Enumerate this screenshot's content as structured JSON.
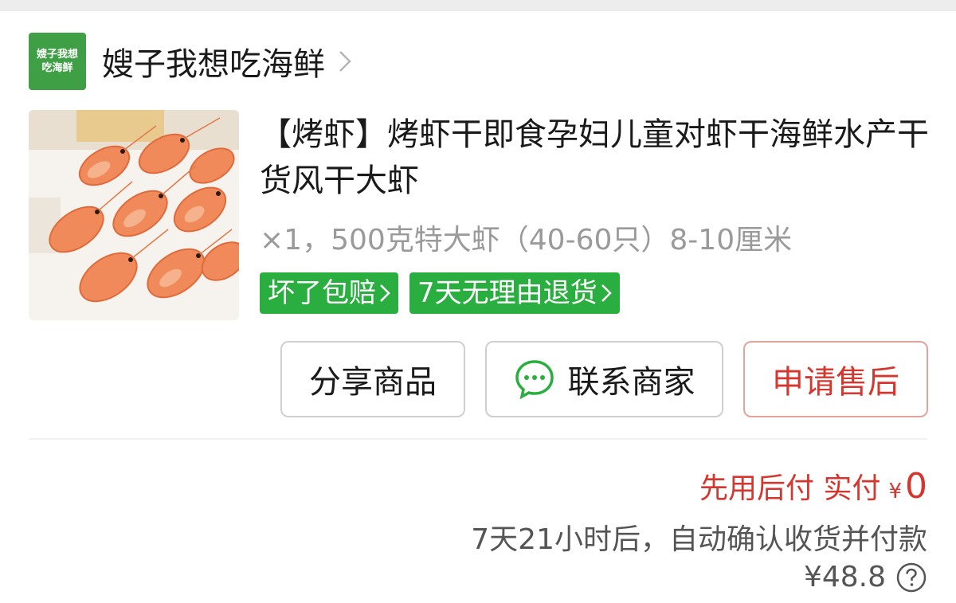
{
  "shop": {
    "logo_line1": "嫂子我想",
    "logo_line2": "吃海鲜",
    "name": "嫂子我想吃海鲜"
  },
  "product": {
    "title": "【烤虾】烤虾干即食孕妇儿童对虾干海鲜水产干货风干大虾",
    "spec": "×1，500克特大虾（40-60只）8-10厘米",
    "tags": [
      "坏了包赔",
      "7天无理由退货"
    ]
  },
  "actions": {
    "share_label": "分享商品",
    "contact_label": "联系商家",
    "aftersale_label": "申请售后"
  },
  "payment": {
    "label": "先用后付 实付",
    "currency": "¥",
    "amount": "0",
    "confirm_text": "7天21小时后，自动确认收货并付款",
    "original_price": "¥48.8"
  },
  "icons": {
    "shop_chevron": "chevron-right-icon",
    "tag_chevron": "chevron-right-icon",
    "chat": "chat-bubble-icon",
    "help": "question-circle-icon"
  },
  "colors": {
    "brand_green": "#2aae3f",
    "logo_green": "#3f9f45",
    "accent_red": "#d5362e",
    "muted_gray": "#9a9a9a"
  }
}
